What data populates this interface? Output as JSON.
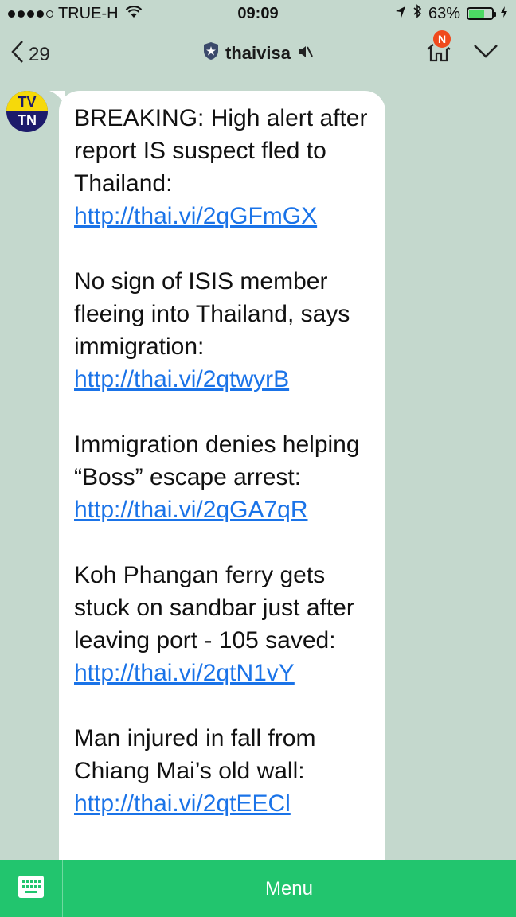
{
  "status_bar": {
    "carrier": "TRUE-H",
    "time": "09:09",
    "battery": "63%",
    "battery_level": 0.63
  },
  "nav": {
    "back_count": "29",
    "title": "thaivisa",
    "notification_badge": "N"
  },
  "avatar": {
    "line1": "TV",
    "line2": "TN"
  },
  "messages": [
    {
      "text": "BREAKING: High alert after report IS suspect fled to Thailand: ",
      "link": "http://thai.vi/2qGFmGX"
    },
    {
      "text": "No sign of ISIS member fleeing into Thailand, says immigration: ",
      "link": "http://thai.vi/2qtwyrB"
    },
    {
      "text": "Immigration denies helping “Boss” escape arrest: ",
      "link": "http://thai.vi/2qGA7qR"
    },
    {
      "text": "Koh Phangan ferry gets stuck on sandbar just after leaving port - 105 saved: ",
      "link": "http://thai.vi/2qtN1vY"
    },
    {
      "text": "Man injured in fall from Chiang Mai’s old wall: ",
      "link": "http://thai.vi/2qtEECl"
    }
  ],
  "bottom_bar": {
    "menu_label": "Menu"
  },
  "colors": {
    "background": "#c4d8cd",
    "accent_green": "#22c56e",
    "link": "#1a73e8",
    "badge": "#f04a1d"
  }
}
